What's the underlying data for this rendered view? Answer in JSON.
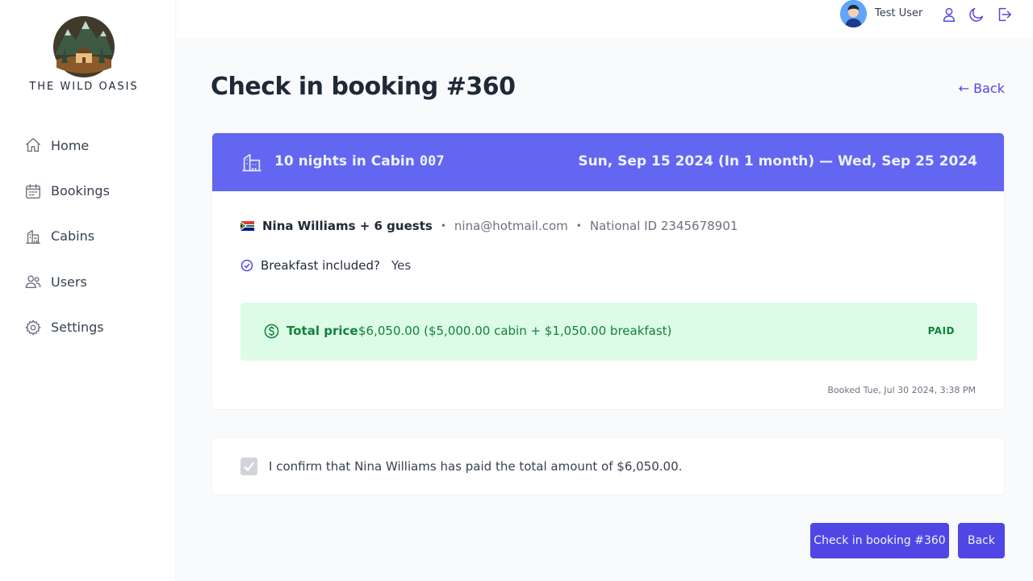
{
  "app": {
    "brand": "THE WILD OASIS"
  },
  "sidebar": {
    "items": [
      {
        "label": "Home",
        "icon": "home-icon"
      },
      {
        "label": "Bookings",
        "icon": "calendar-icon"
      },
      {
        "label": "Cabins",
        "icon": "cabin-icon"
      },
      {
        "label": "Users",
        "icon": "users-icon"
      },
      {
        "label": "Settings",
        "icon": "gear-icon"
      }
    ]
  },
  "header": {
    "username": "Test User",
    "icons": [
      "user-icon",
      "moon-icon",
      "logout-icon"
    ]
  },
  "page": {
    "title": "Check in booking #360",
    "back_link": "← Back"
  },
  "booking": {
    "nights": "10 nights in Cabin",
    "cabin_number": "007",
    "dates": "Sun, Sep 15 2024 (In 1 month) — Wed, Sep 25 2024",
    "guest": "Nina Williams + 6 guests",
    "email": "nina@hotmail.com",
    "national_id": "National ID 2345678901",
    "breakfast_label": "Breakfast included?",
    "breakfast_value": "Yes",
    "total_label": "Total price",
    "total_value": "$6,050.00 ($5,000.00 cabin + $1,050.00 breakfast)",
    "paid_status": "PAID",
    "booked_at": "Booked Tue, Jul 30 2024, 3:38 PM",
    "separator": "•"
  },
  "confirm": {
    "text": "I confirm that Nina Williams has paid the total amount of $6,050.00.",
    "checked": true
  },
  "actions": {
    "checkin_label": "Check in booking #360",
    "back_label": "Back"
  },
  "colors": {
    "accent": "#4f46e5",
    "header_band": "#6366f1",
    "paid_bg": "#dcfce7",
    "paid_text": "#15803d"
  }
}
